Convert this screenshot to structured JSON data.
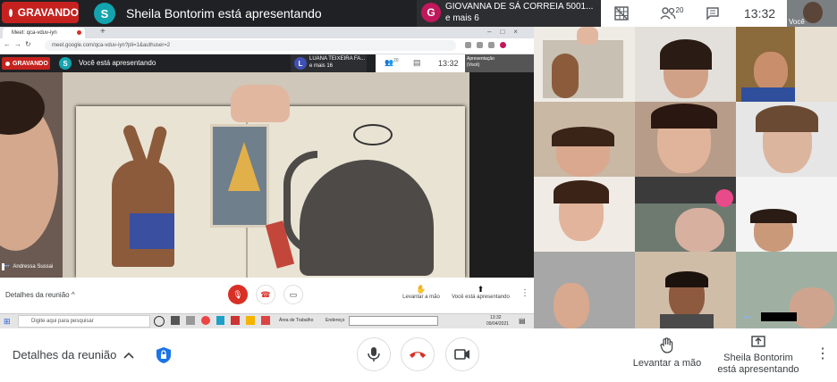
{
  "outer_top": {
    "recording_label": "GRAVANDO",
    "presenter_avatar_letter": "S",
    "presenter_text": "Sheila Bontorim está apresentando",
    "participant_avatar_letter": "G",
    "participant_name": "GIOVANNA DE SÁ CORREIA 5001...",
    "participant_more": "e mais 6",
    "people_count": "20",
    "time": "13:32",
    "self_label": "Você"
  },
  "inner_browser": {
    "tab_title": "Meet: qca-vduv-iyn",
    "url": "meet.google.com/qca-vduv-iyn?pli=1&authuser=2",
    "recording_label": "GRAVANDO",
    "presenter_avatar_letter": "S",
    "presenter_text": "Você está apresentando",
    "participant_avatar_letter": "L",
    "participant_name": "LUANA TEIXEIRA FA...",
    "participant_more": "e mais 16",
    "people_count": "20",
    "time": "13:32",
    "presentation_label": "Apresentação (Você)",
    "speaker_name": "Andressa Sussai",
    "meeting_details": "Detalhes da reunião",
    "raise_hand": "Levantar a mão",
    "presenting": "Você está apresentando",
    "taskbar_search": "Digite aqui para pesquisar",
    "taskbar_desktop": "Área de Trabalho",
    "taskbar_address": "Endereço",
    "taskbar_time": "13:32",
    "taskbar_date": "09/04/2021"
  },
  "bottom": {
    "meeting_details": "Detalhes da reunião",
    "raise_hand": "Levantar a mão",
    "presenter_line1": "Sheila Bontorim",
    "presenter_line2": "está apresentando"
  },
  "colors": {
    "record_red": "#c5221f",
    "presenter_avatar": "#12a4af",
    "participant_avatar": "#c2185b",
    "hangup_red": "#d93025",
    "shield_blue": "#1a73e8"
  }
}
